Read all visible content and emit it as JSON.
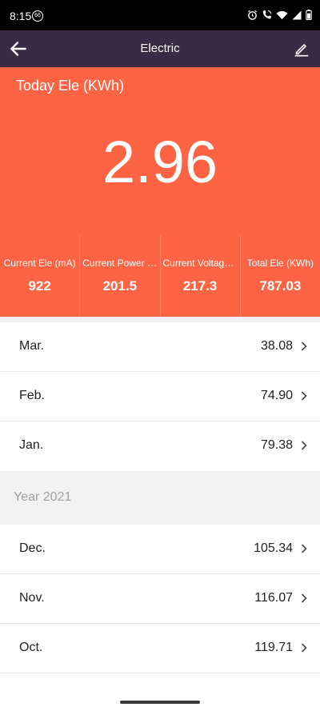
{
  "status_bar": {
    "time": "8:15",
    "notification_badge": "66",
    "icons": [
      "alarm-icon",
      "wifi-calling-icon",
      "wifi-icon",
      "signal-icon",
      "battery-icon"
    ]
  },
  "app_bar": {
    "title": "Electric",
    "icons": [
      "back-arrow-icon",
      "edit-pencil-icon"
    ]
  },
  "hero": {
    "label": "Today Ele (KWh)",
    "value": "2.96",
    "background": "#fe6343",
    "stats": [
      {
        "label": "Current Ele (mA)",
        "value": "922"
      },
      {
        "label": "Current Power (…",
        "value": "201.5"
      },
      {
        "label": "Current Voltage…",
        "value": "217.3"
      },
      {
        "label": "Total Ele (KWh)",
        "value": "787.03"
      }
    ]
  },
  "months_current": [
    {
      "label": "Mar.",
      "value": "38.08"
    },
    {
      "label": "Feb.",
      "value": "74.90"
    },
    {
      "label": "Jan.",
      "value": "79.38"
    }
  ],
  "year_header": "Year 2021",
  "months_2021": [
    {
      "label": "Dec.",
      "value": "105.34"
    },
    {
      "label": "Nov.",
      "value": "116.07"
    },
    {
      "label": "Oct.",
      "value": "119.71"
    }
  ]
}
